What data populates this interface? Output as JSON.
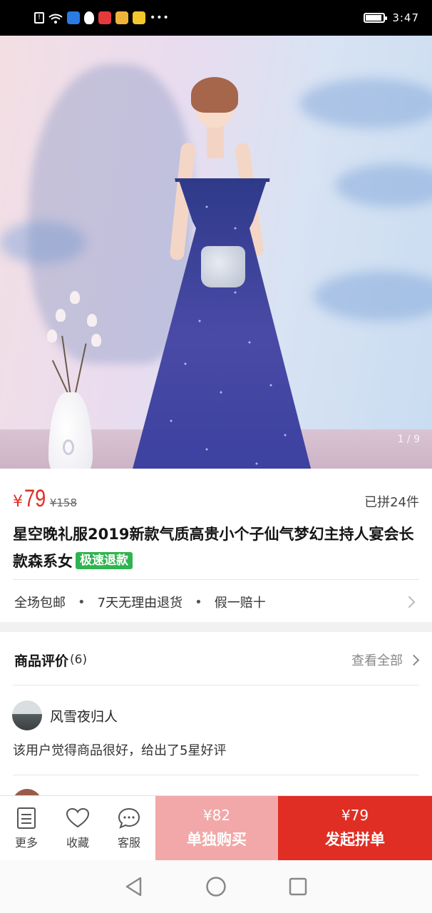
{
  "status_bar": {
    "time": "3:47",
    "icons": [
      "alert-icon",
      "wifi-icon",
      "shield-app-icon",
      "qq-icon",
      "app-icon",
      "weibo-icon",
      "fruit-app-icon",
      "more-dots-icon"
    ],
    "battery_level": 0.85
  },
  "gallery": {
    "counter": "1 / 9"
  },
  "product": {
    "currency": "¥",
    "price": "79",
    "original_price": "¥158",
    "sold": "已拼24件",
    "title": "星空晚礼服2019新款气质高贵小个子仙气梦幻主持人宴会长款森系女",
    "badge": "极速退款"
  },
  "services": {
    "items": [
      "全场包邮",
      "7天无理由退货",
      "假一赔十"
    ],
    "separator": "•"
  },
  "reviews": {
    "label": "商品评价",
    "count": "(6)",
    "see_all": "查看全部",
    "first": {
      "name": "风雪夜归人",
      "text": "该用户觉得商品很好，给出了5星好评"
    }
  },
  "bottom_bar": {
    "more": "更多",
    "favorite": "收藏",
    "service": "客服",
    "single_price": "¥82",
    "single_label": "单独购买",
    "group_price": "¥79",
    "group_label": "发起拼单"
  },
  "colors": {
    "accent": "#e02e24",
    "single_button": "#f2a8a8",
    "badge": "#2fb44f"
  }
}
